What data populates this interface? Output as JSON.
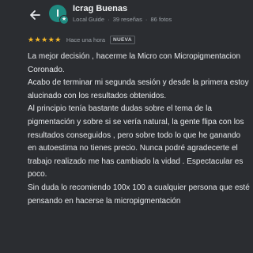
{
  "header": {
    "back_icon": "back-arrow-icon",
    "avatar_letter": "I",
    "business_name": "Icrag Buenas",
    "guide_label": "Local Guide",
    "reviews_count": "39 reseñas",
    "photos_count": "86 fotos",
    "separator": "·"
  },
  "review": {
    "stars": "★★★★★",
    "time": "Hace una hora",
    "new_label": "NUEVA",
    "paragraphs": [
      "La mejor decisión , hacerme la Micro con Micropigmentacion Coronado.",
      "Acabo de terminar mi segunda sesión y desde la primera estoy alucinado con los resultados obtenidos.",
      "Al principio tenía bastante dudas sobre el tema de la pigmentación y sobre si se vería natural, la gente flipa con los resultados conseguidos , pero sobre todo lo que he ganando en autoestima no tienes precio. Nunca podré agradecerte el trabajo realizado me has cambiado la vidad . Espectacular es poco.",
      "Sin duda lo recomiendo 100x 100 a cualquier persona que esté pensando en hacerse la micropigmentación"
    ]
  },
  "colors": {
    "background": "#2b2d31",
    "avatar": "#1f8a80",
    "star": "#f7b928"
  }
}
